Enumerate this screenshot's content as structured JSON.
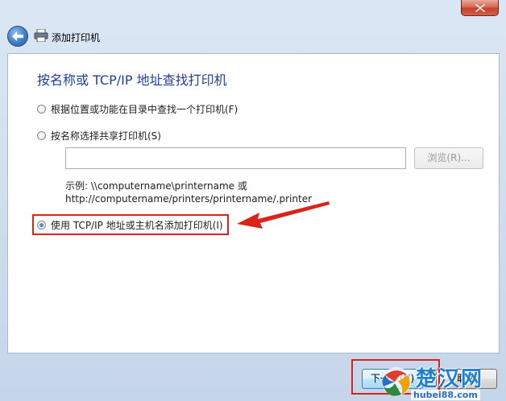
{
  "window": {
    "title": "添加打印机",
    "close_icon": "close-icon",
    "back_icon": "back-arrow-icon",
    "printer_icon": "printer-icon"
  },
  "main": {
    "heading": "按名称或 TCP/IP 地址查找打印机",
    "options": [
      {
        "label": "根据位置或功能在目录中查找一个打印机(F)",
        "checked": false
      },
      {
        "label": "按名称选择共享打印机(S)",
        "checked": false
      },
      {
        "label": "使用 TCP/IP 地址或主机名添加打印机(I)",
        "checked": true
      }
    ],
    "share_input": {
      "value": "",
      "placeholder": ""
    },
    "browse_label": "浏览(R)...",
    "example_line1": "示例: \\\\computername\\printername 或",
    "example_line2": "http://computername/printers/printername/.printer"
  },
  "footer": {
    "next_label": "下一步(N)",
    "cancel_label": "取消"
  },
  "watermark": {
    "brand": "楚汉网",
    "url": "hubei88.com"
  },
  "colors": {
    "heading": "#1f3f9e",
    "annotation_red": "#d9231b",
    "frame": "#cddced"
  }
}
